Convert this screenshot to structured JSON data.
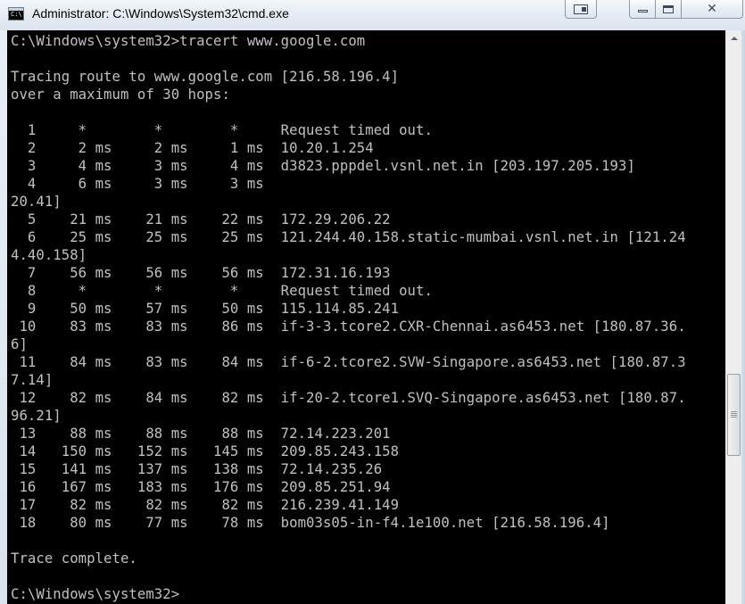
{
  "window": {
    "title": "Administrator: C:\\Windows\\System32\\cmd.exe",
    "icon_name": "cmd-icon",
    "icon_text": "C:\\"
  },
  "controls": {
    "extra_icon": "window-pin-icon",
    "minimize_icon": "minimize-icon",
    "maximize_icon": "maximize-icon",
    "close_icon": "close-icon",
    "close_glyph": "✕"
  },
  "console": {
    "background": "#000000",
    "foreground": "#c0c0c0",
    "lines": [
      "C:\\Windows\\system32>tracert www.google.com",
      "",
      "Tracing route to www.google.com [216.58.196.4]",
      "over a maximum of 30 hops:",
      "",
      "  1     *        *        *     Request timed out.",
      "  2     2 ms     2 ms     1 ms  10.20.1.254",
      "  3     4 ms     3 ms     4 ms  d3823.pppdel.vsnl.net.in [203.197.205.193]",
      "  4     6 ms     3 ms     3 ms",
      "20.41]",
      "  5    21 ms    21 ms    22 ms  172.29.206.22",
      "  6    25 ms    25 ms    25 ms  121.244.40.158.static-mumbai.vsnl.net.in [121.24",
      "4.40.158]",
      "  7    56 ms    56 ms    56 ms  172.31.16.193",
      "  8     *        *        *     Request timed out.",
      "  9    50 ms    57 ms    50 ms  115.114.85.241",
      " 10    83 ms    83 ms    86 ms  if-3-3.tcore2.CXR-Chennai.as6453.net [180.87.36.",
      "6]",
      " 11    84 ms    83 ms    84 ms  if-6-2.tcore2.SVW-Singapore.as6453.net [180.87.3",
      "7.14]",
      " 12    82 ms    84 ms    82 ms  if-20-2.tcore1.SVQ-Singapore.as6453.net [180.87.",
      "96.21]",
      " 13    88 ms    88 ms    88 ms  72.14.223.201",
      " 14   150 ms   152 ms   145 ms  209.85.243.158",
      " 15   141 ms   137 ms   138 ms  72.14.235.26",
      " 16   167 ms   183 ms   176 ms  209.85.251.94",
      " 17    82 ms    82 ms    82 ms  216.239.41.149",
      " 18    80 ms    77 ms    78 ms  bom03s05-in-f4.1e100.net [216.58.196.4]",
      "",
      "Trace complete.",
      "",
      "C:\\Windows\\system32>"
    ]
  },
  "scrollbar": {
    "up_arrow_icon": "scroll-up-arrow-icon",
    "position_fraction": 0.82
  }
}
